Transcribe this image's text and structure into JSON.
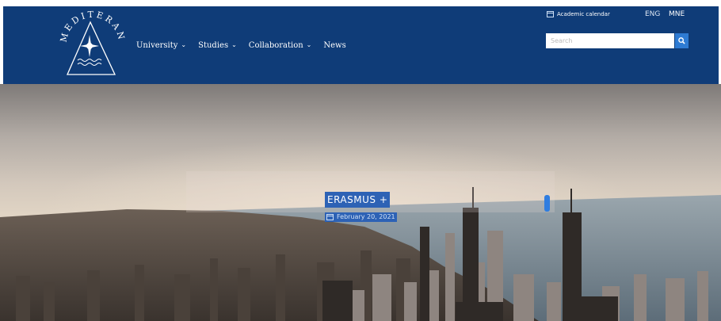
{
  "header": {
    "logo_text": "MEDITERAN",
    "nav": [
      {
        "label": "University",
        "has_dropdown": true
      },
      {
        "label": "Studies",
        "has_dropdown": true
      },
      {
        "label": "Collaboration",
        "has_dropdown": true
      },
      {
        "label": "News",
        "has_dropdown": false
      }
    ],
    "academic_calendar": "Academic calendar",
    "languages": [
      "ENG",
      "MNE"
    ],
    "search": {
      "placeholder": "Search",
      "icon": "search-icon"
    }
  },
  "hero": {
    "title": "ERASMUS +",
    "date": "February 20, 2021",
    "date_icon": "calendar-icon"
  },
  "colors": {
    "header_bg": "#0f3c78",
    "accent": "#2d62b5",
    "search_button": "#2e7bd3"
  }
}
